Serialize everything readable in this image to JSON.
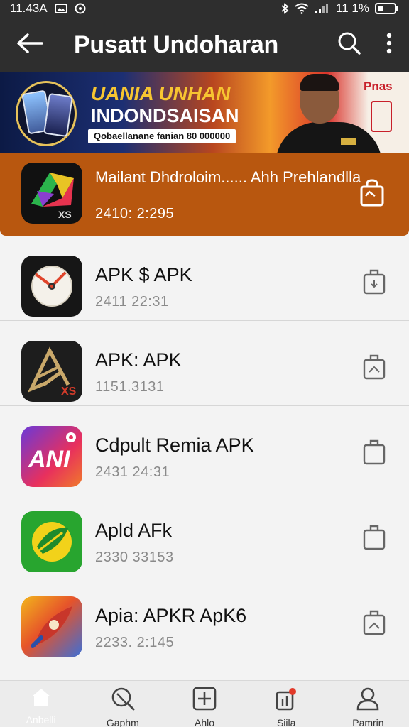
{
  "status_bar": {
    "time": "11.43A",
    "battery_text": "11 1%"
  },
  "app_bar": {
    "title": "Pusatt Undoharan"
  },
  "banner": {
    "line1": "UANIA UNHAN",
    "line2": "INDONDSAISAN",
    "sub": "Qobaellanane fanian 80 000000",
    "brand": "Pnas"
  },
  "featured": {
    "title": "Mailant Dhdroloim...... Ahh Prehlandlla",
    "date": "2410: 2:295",
    "icon": "xs-colorful-logo-icon"
  },
  "items": [
    {
      "title": "APK $ APK",
      "date": "2411 22:31",
      "icon": "compass-clock-icon"
    },
    {
      "title": "APK: APK",
      "date": "1151.3131",
      "icon": "gold-a-xs-icon"
    },
    {
      "title": "Cdpult Remia APK",
      "date": "2431 24:31",
      "icon": "ani-gradient-icon"
    },
    {
      "title": "Apld AFk",
      "date": "2330 33153",
      "icon": "green-leaf-icon"
    },
    {
      "title": "Apia: APKR ApK6",
      "date": "2233. 2:145",
      "icon": "rocket-icon"
    }
  ],
  "bottom_nav": [
    {
      "label": "Anbelli",
      "icon": "home-icon"
    },
    {
      "label": "Gaphm",
      "icon": "search-icon"
    },
    {
      "label": "Ahlo",
      "icon": "plus-square-icon"
    },
    {
      "label": "Siila",
      "icon": "notification-icon"
    },
    {
      "label": "Pamrin",
      "icon": "profile-icon"
    }
  ],
  "colors": {
    "app_bar": "#2e2e2e",
    "featured": "#b8570f",
    "background": "#f3f3f3"
  }
}
